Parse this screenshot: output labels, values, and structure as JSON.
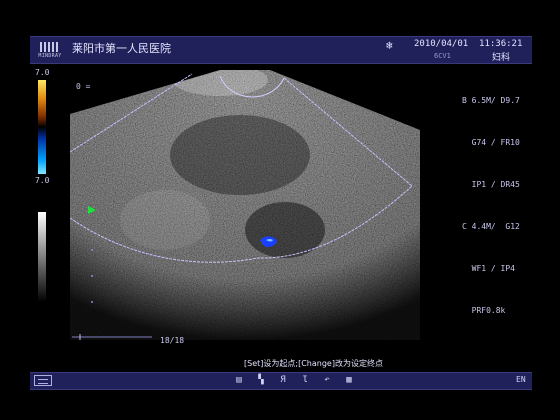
{
  "header": {
    "logo_text": "MINDRAY",
    "hospital": "莱阳市第一人民医院",
    "freeze_icon": "snowflake-icon",
    "datetime": "2010/04/01  11:36:21",
    "probe": "6CV1",
    "department": "妇科"
  },
  "params": {
    "b_label": "B",
    "b_line1": "6.5M/ D9.7",
    "b_line2": "G74 / FR10",
    "b_line3": "IP1 / DR45",
    "c_label": "C",
    "c_line1": "4.4M/  G12",
    "c_line2": "WF1 / IP4",
    "c_line3": "PRF0.8k"
  },
  "colorbar": {
    "top": "7.0",
    "bottom": "7.0"
  },
  "zero_label": "0 =",
  "frame": "18/18",
  "hint": "[Set]设为起点;[Change]改为设定终点",
  "bottombar": {
    "tools": [
      "list-icon",
      "cursor-icon",
      "flip-r-icon",
      "flip-l-icon",
      "rotate-icon",
      "grid-icon"
    ],
    "tool_glyphs": [
      "▤",
      "▚",
      "Я",
      "Ɩ",
      "↶",
      "▦"
    ],
    "lang": "EN"
  }
}
